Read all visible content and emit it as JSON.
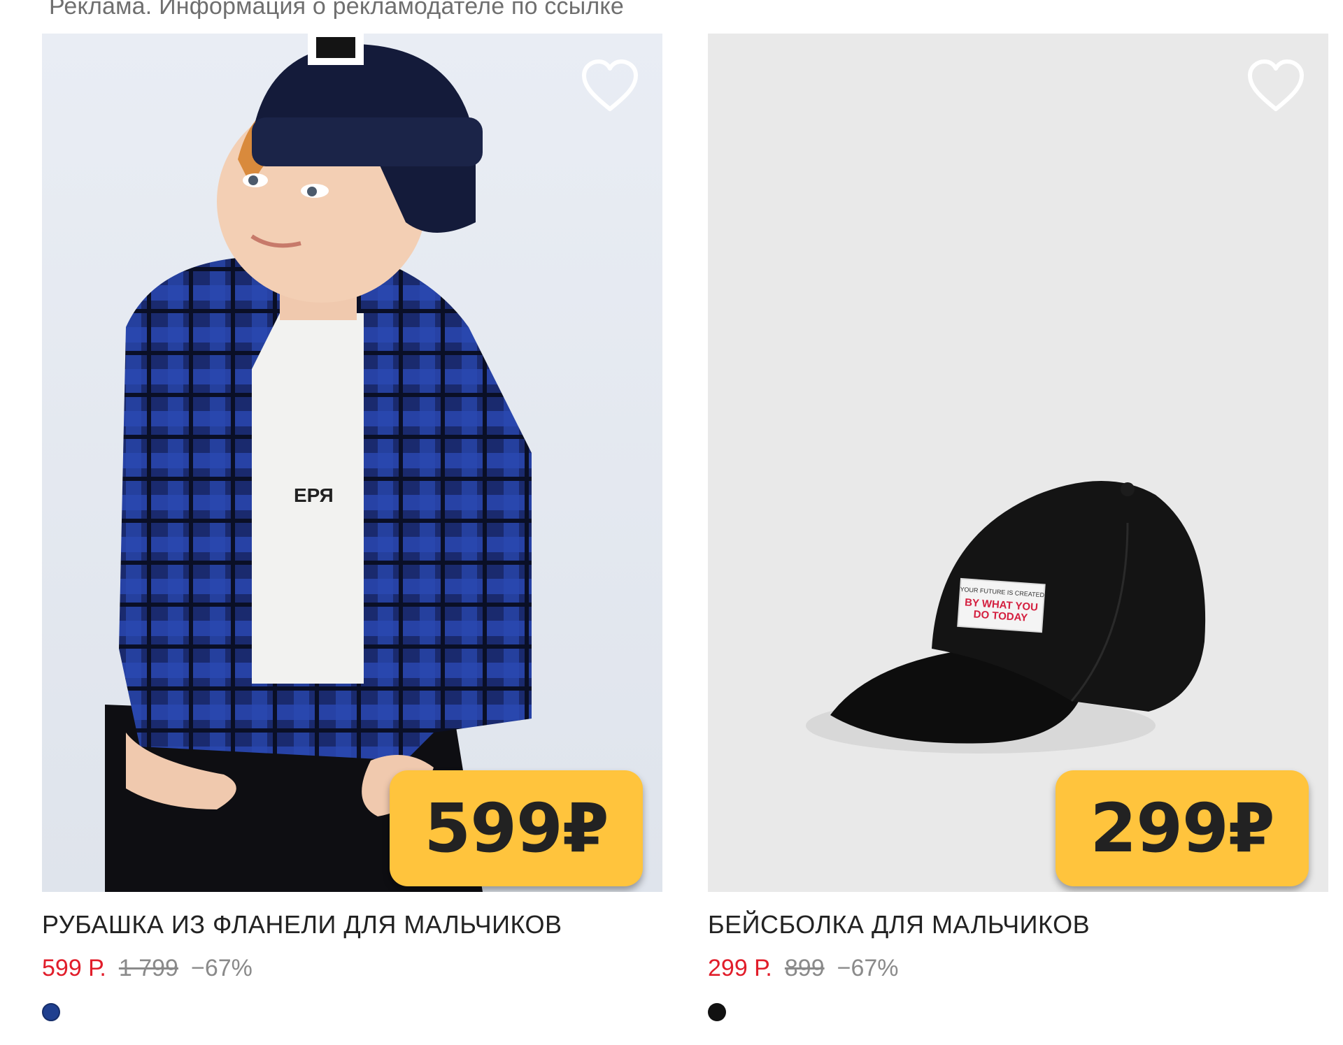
{
  "ad_notice": "Реклама. Информация о рекламодателе по ссылке",
  "products": [
    {
      "title": "РУБАШКА ИЗ ФЛАНЕЛИ ДЛЯ МАЛЬЧИКОВ",
      "badge_price": "599₽",
      "price": "599 Р.",
      "old_price": "1 799",
      "discount": "−67%",
      "swatch_color": "#1f3f8f",
      "image_icon": "boy-in-flannel-shirt-photo",
      "favorite_icon": "heart-outline-icon"
    },
    {
      "title": "БЕЙСБОЛКА ДЛЯ МАЛЬЧИКОВ",
      "badge_price": "299₽",
      "price": "299 Р.",
      "old_price": "899",
      "discount": "−67%",
      "swatch_color": "#111111",
      "image_icon": "black-baseball-cap-photo",
      "favorite_icon": "heart-outline-icon",
      "cap_patch_text": "BY WHAT YOU DO TODAY"
    }
  ],
  "colors": {
    "badge": "#ffc43d",
    "sale_price": "#e11d2a",
    "muted": "#8a8a8a"
  }
}
